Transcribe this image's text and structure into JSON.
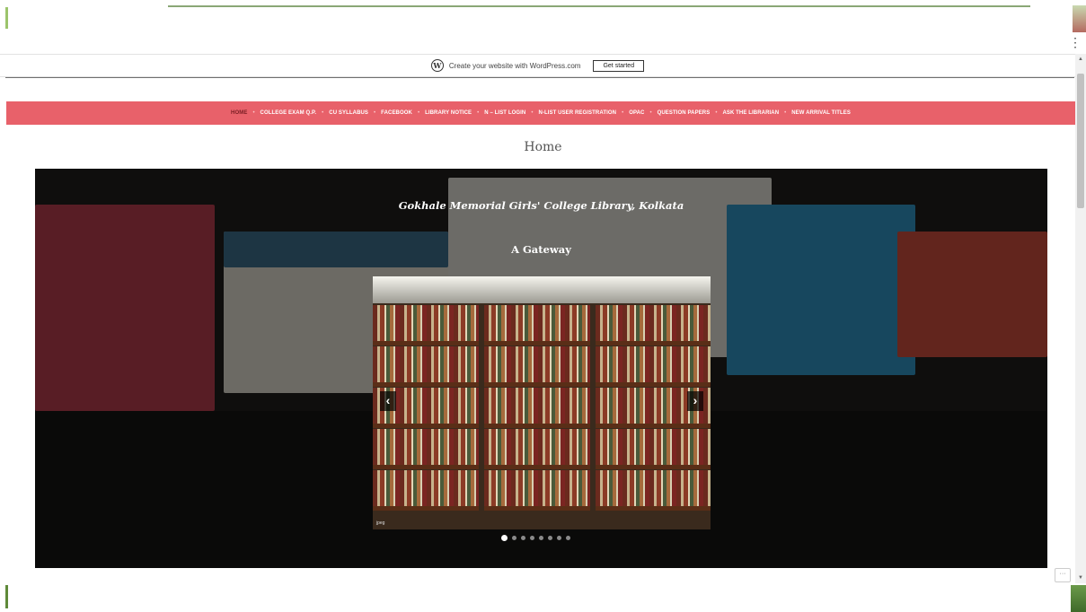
{
  "wp_banner": {
    "text": "Create your website with WordPress.com",
    "button": "Get started",
    "logo_icon": "wordpress-icon"
  },
  "nav": {
    "items": [
      {
        "label": "HOME",
        "active": true
      },
      {
        "label": "COLLEGE EXAM Q.P."
      },
      {
        "label": "CU SYLLABUS"
      },
      {
        "label": "FACEBOOK"
      },
      {
        "label": "LIBRARY NOTICE"
      },
      {
        "label": "N – LIST LOGIN"
      },
      {
        "label": "N-LIST USER REGISTRATION"
      },
      {
        "label": "OPAC"
      },
      {
        "label": "QUESTION PAPERS"
      },
      {
        "label": "ASK THE LIBRARIAN"
      },
      {
        "label": "NEW ARRIVAL TITLES"
      }
    ],
    "separator": "•"
  },
  "page": {
    "title": "Home"
  },
  "hero": {
    "title": "Gokhale Memorial Girls' College Library, Kolkata",
    "subtitle": "A Gateway",
    "slideshow": {
      "caption": "jpeg",
      "prev_icon": "chevron-left-icon",
      "next_icon": "chevron-right-icon",
      "dot_count": 8,
      "active_index": 0
    }
  },
  "colors": {
    "nav_bg": "#e8616a",
    "nav_active": "#7a1e24"
  }
}
